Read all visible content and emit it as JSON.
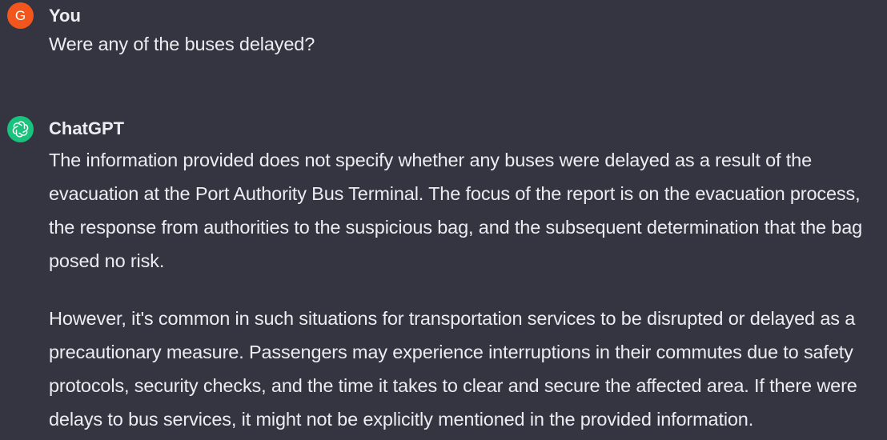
{
  "conversation": {
    "user_message": {
      "avatar_letter": "G",
      "author": "You",
      "text": "Were any of the buses delayed?"
    },
    "assistant_message": {
      "author": "ChatGPT",
      "avatar_icon": "openai-logo-icon",
      "paragraphs": [
        "The information provided does not specify whether any buses were delayed as a result of the evacuation at the Port Authority Bus Terminal. The focus of the report is on the evacuation process, the response from authorities to the suspicious bag, and the subsequent determination that the bag posed no risk.",
        "However, it's common in such situations for transportation services to be disrupted or delayed as a precautionary measure. Passengers may experience interruptions in their commutes due to safety protocols, security checks, and the time it takes to clear and secure the affected area. If there were delays to bus services, it might not be explicitly mentioned in the provided information."
      ]
    }
  },
  "colors": {
    "background": "#343541",
    "text": "#ececf1",
    "user_avatar": "#f2561d",
    "assistant_avatar": "#19c37d"
  }
}
